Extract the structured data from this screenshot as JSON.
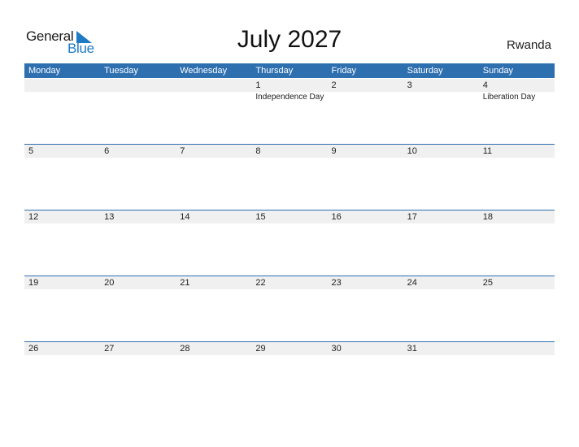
{
  "logo": {
    "word1": "General",
    "word2": "Blue"
  },
  "header": {
    "title": "July 2027",
    "country": "Rwanda"
  },
  "colors": {
    "accent": "#2e6fb0",
    "logo_blue": "#1f7ac4",
    "strip": "#f0f0f0"
  },
  "weekdays": [
    "Monday",
    "Tuesday",
    "Wednesday",
    "Thursday",
    "Friday",
    "Saturday",
    "Sunday"
  ],
  "weeks": [
    {
      "days": [
        {
          "num": "",
          "holiday": ""
        },
        {
          "num": "",
          "holiday": ""
        },
        {
          "num": "",
          "holiday": ""
        },
        {
          "num": "1",
          "holiday": "Independence Day"
        },
        {
          "num": "2",
          "holiday": ""
        },
        {
          "num": "3",
          "holiday": ""
        },
        {
          "num": "4",
          "holiday": "Liberation Day"
        }
      ]
    },
    {
      "days": [
        {
          "num": "5",
          "holiday": ""
        },
        {
          "num": "6",
          "holiday": ""
        },
        {
          "num": "7",
          "holiday": ""
        },
        {
          "num": "8",
          "holiday": ""
        },
        {
          "num": "9",
          "holiday": ""
        },
        {
          "num": "10",
          "holiday": ""
        },
        {
          "num": "11",
          "holiday": ""
        }
      ]
    },
    {
      "days": [
        {
          "num": "12",
          "holiday": ""
        },
        {
          "num": "13",
          "holiday": ""
        },
        {
          "num": "14",
          "holiday": ""
        },
        {
          "num": "15",
          "holiday": ""
        },
        {
          "num": "16",
          "holiday": ""
        },
        {
          "num": "17",
          "holiday": ""
        },
        {
          "num": "18",
          "holiday": ""
        }
      ]
    },
    {
      "days": [
        {
          "num": "19",
          "holiday": ""
        },
        {
          "num": "20",
          "holiday": ""
        },
        {
          "num": "21",
          "holiday": ""
        },
        {
          "num": "22",
          "holiday": ""
        },
        {
          "num": "23",
          "holiday": ""
        },
        {
          "num": "24",
          "holiday": ""
        },
        {
          "num": "25",
          "holiday": ""
        }
      ]
    },
    {
      "days": [
        {
          "num": "26",
          "holiday": ""
        },
        {
          "num": "27",
          "holiday": ""
        },
        {
          "num": "28",
          "holiday": ""
        },
        {
          "num": "29",
          "holiday": ""
        },
        {
          "num": "30",
          "holiday": ""
        },
        {
          "num": "31",
          "holiday": ""
        },
        {
          "num": "",
          "holiday": ""
        }
      ]
    }
  ]
}
